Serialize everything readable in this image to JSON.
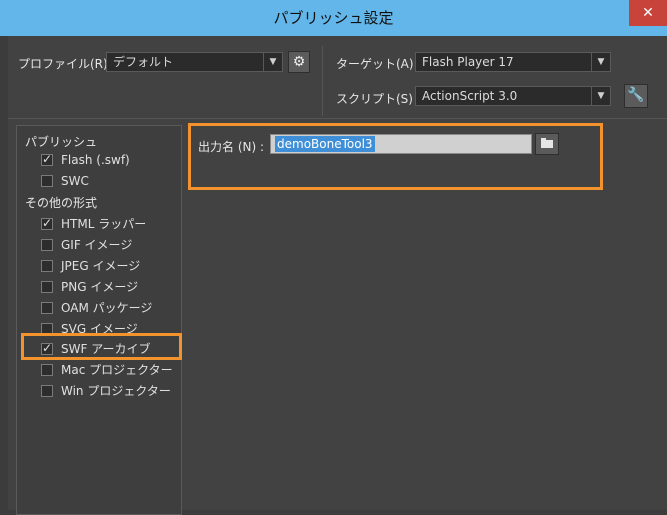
{
  "window": {
    "title": "パブリッシュ設定",
    "close_icon": "close-icon"
  },
  "profile": {
    "label": "プロファイル(R) :",
    "value": "デフォルト"
  },
  "target": {
    "label": "ターゲット(A) :",
    "value": "Flash Player 17"
  },
  "script": {
    "label": "スクリプト(S) :",
    "value": "ActionScript 3.0"
  },
  "left_panel": {
    "publish_group": "パブリッシュ",
    "other_group": "その他の形式",
    "items": [
      {
        "label": "Flash (.swf)",
        "checked": true
      },
      {
        "label": "SWC",
        "checked": false
      },
      {
        "label": "HTML ラッパー",
        "checked": true
      },
      {
        "label": "GIF イメージ",
        "checked": false
      },
      {
        "label": "JPEG イメージ",
        "checked": false
      },
      {
        "label": "PNG イメージ",
        "checked": false
      },
      {
        "label": "OAM パッケージ",
        "checked": false
      },
      {
        "label": "SVG イメージ",
        "checked": false
      },
      {
        "label": "SWF アーカイブ",
        "checked": true
      },
      {
        "label": "Mac プロジェクター",
        "checked": false
      },
      {
        "label": "Win プロジェクター",
        "checked": false
      }
    ]
  },
  "output": {
    "label": "出力名 (N) :",
    "value": "demoBoneTool3"
  },
  "colors": {
    "highlight": "#f2932d",
    "titlebar": "#63b6ea",
    "selection": "#3f8fd8"
  }
}
